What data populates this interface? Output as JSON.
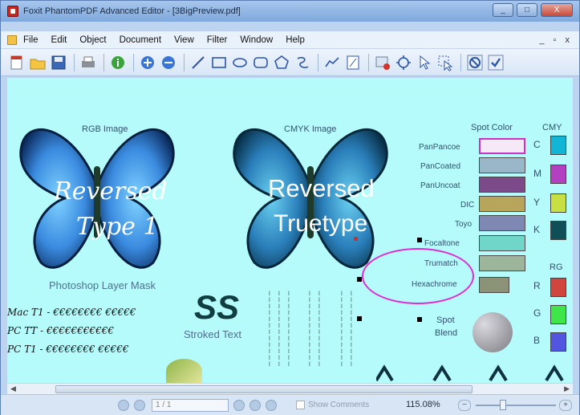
{
  "window": {
    "title": "Foxit PhantomPDF Advanced Editor - [3BigPreview.pdf]",
    "minimize": "_",
    "maximize": "□",
    "close": "X"
  },
  "menu": {
    "items": [
      "File",
      "Edit",
      "Object",
      "Document",
      "View",
      "Filter",
      "Window",
      "Help"
    ],
    "controls": "_ ▫ x"
  },
  "toolbar": {
    "icons": [
      "new-document-icon",
      "open-folder-icon",
      "save-icon",
      "print-icon",
      "info-icon",
      "zoom-in-icon",
      "zoom-out-icon",
      "line-icon",
      "rectangle-icon",
      "ellipse-icon",
      "rounded-rectangle-icon",
      "polygon-icon",
      "spiral-icon",
      "polyline-icon",
      "text-block-icon",
      "image-edit-icon",
      "move-icon",
      "select-arrow-icon",
      "select-hand-icon",
      "circle-slash-icon",
      "checkmark-icon"
    ]
  },
  "document": {
    "rgb_label": "RGB Image",
    "cmyk_label": "CMYK Image",
    "reversed1": "Reversed",
    "type1": "Type 1",
    "reversed2": "Reversed",
    "truetype": "Truetype",
    "photoshop": "Photoshop Layer Mask",
    "ss": "SS",
    "stroked": "Stroked Text",
    "font_lines": [
      "Mac T1 - €€€€€€€€ €€€€€",
      "PC TT - €€€€€€€€€€€",
      "PC T1 - €€€€€€€€ €€€€€"
    ],
    "spot_color": "Spot Color",
    "cmyk_col": "CMY",
    "rgb_col": "RG",
    "swatch_labels": [
      "PanPancoe",
      "PanCoated",
      "PanUncoat",
      "DIC",
      "Toyo",
      "Focaltone",
      "Trumatch",
      "Hexachrome"
    ],
    "swatch_colors": [
      "#f5e9f7",
      "#9ab6c9",
      "#7d4a89",
      "#b7a55b",
      "#7f87b3",
      "#6fd6c9",
      "#9db59a",
      "#8c9276"
    ],
    "spot_blend_1": "Spot",
    "spot_blend_2": "Blend",
    "cmyk_letters": [
      "C",
      "M",
      "Y",
      "K"
    ],
    "cmyk_colors": [
      "#11b6d6",
      "#b340c1",
      "#c9e042",
      "#0f4f58"
    ],
    "rgb_letters": [
      "R",
      "G",
      "B"
    ],
    "rgb_colors": [
      "#d1453f",
      "#3fe64a",
      "#5255e0"
    ]
  },
  "status": {
    "page": "1 / 1",
    "show_comments": "Show Comments",
    "zoom": "115.08%"
  }
}
